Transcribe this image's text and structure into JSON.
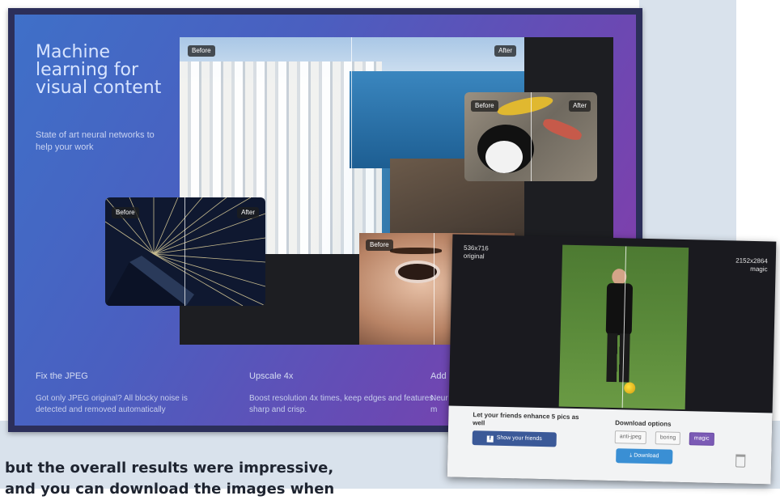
{
  "hero": {
    "title": "Machine learning for visual content",
    "subtitle": "State of art neural networks to help your work"
  },
  "collage": {
    "before_label": "Before",
    "after_label": "After"
  },
  "features": [
    {
      "title": "Fix the JPEG",
      "desc": "Got only JPEG original? All blocky noise is detected and removed automatically"
    },
    {
      "title": "Upscale 4x",
      "desc": "Boost resolution 4x times, keep edges and features sharp and crisp."
    },
    {
      "title": "Add",
      "desc": "Neur to m"
    }
  ],
  "app": {
    "original_size": "536x716",
    "original_label": "original",
    "magic_size": "2152x2864",
    "magic_label": "magic",
    "share_text": "Let your friends enhance 5 pics as well",
    "share_button": "Show your friends",
    "download_title": "Download options",
    "options": [
      "anti-jpeg",
      "boring",
      "magic"
    ],
    "active_option": "magic",
    "download_button": "Download"
  },
  "caption": {
    "line1": "but the overall results were impressive,",
    "line2": "and you can download the images when"
  },
  "colors": {
    "accent_purple": "#7b5ab5",
    "facebook_blue": "#3b5998",
    "download_blue": "#3a8fd4"
  }
}
